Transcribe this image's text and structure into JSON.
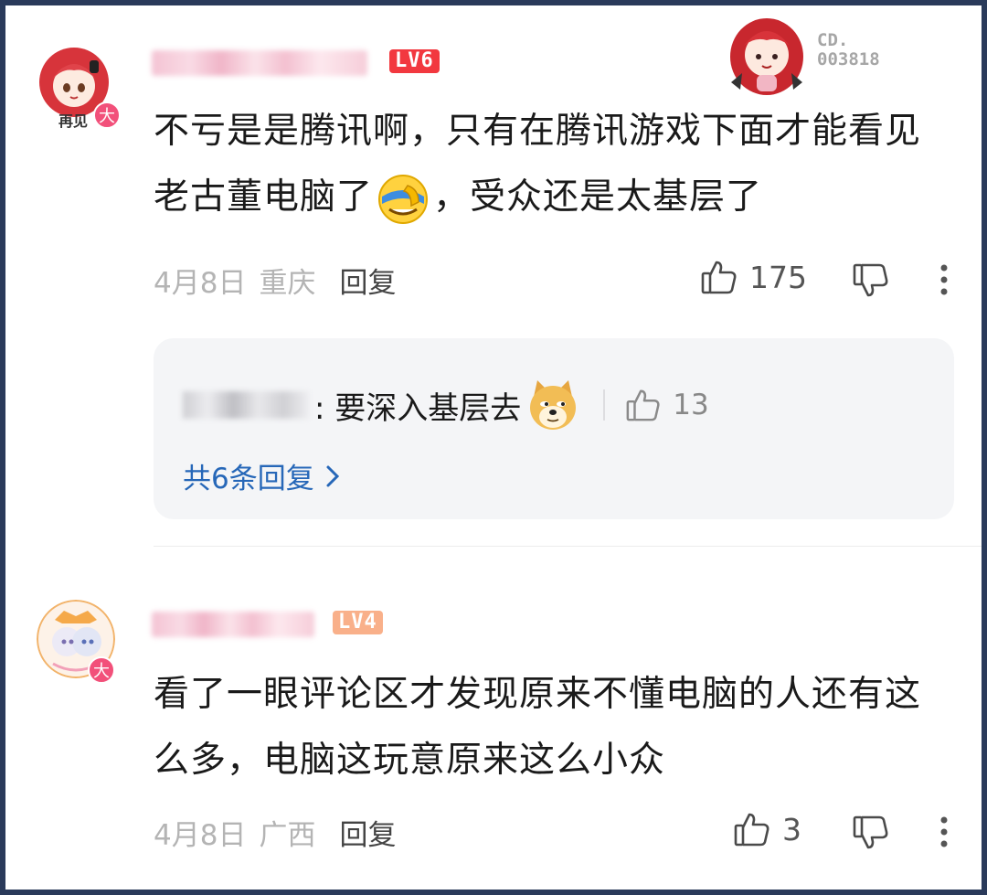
{
  "watermark": {
    "line1": "CD.",
    "line2": "003818"
  },
  "comments": [
    {
      "level": "LV6",
      "avatar_caption": "再见",
      "badge": "大",
      "text_part1": "不亏是是腾讯啊，只有在腾讯游戏下面才能看见老古董电脑了",
      "text_part2": "，受众还是太基层了",
      "date": "4月8日",
      "location": "重庆",
      "reply_label": "回复",
      "likes": "175"
    },
    {
      "level": "LV4",
      "badge": "大",
      "text": "看了一眼评论区才发现原来不懂电脑的人还有这么多，电脑这玩意原来这么小众",
      "date": "4月8日",
      "location": "广西",
      "reply_label": "回复",
      "likes": "3"
    }
  ],
  "reply_preview": {
    "text": ": 要深入基层去",
    "likes": "13",
    "view_all": "共6条回复"
  },
  "colors": {
    "lv6": "#f2383f",
    "lv4": "#f9b08a",
    "link": "#2667b8",
    "badge": "#f2507a"
  },
  "icons": [
    "thumbs-up-icon",
    "thumbs-down-icon",
    "more-icon",
    "chevron-right-icon"
  ]
}
